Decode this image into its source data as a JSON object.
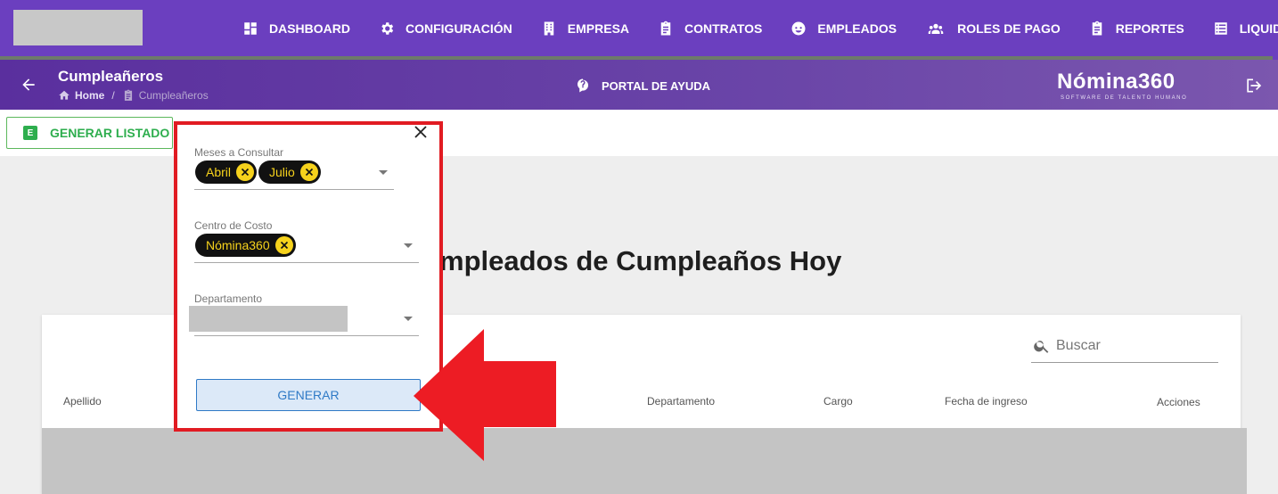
{
  "nav": {
    "items": [
      {
        "label": "DASHBOARD",
        "icon": "dashboard-icon"
      },
      {
        "label": "CONFIGURACIÓN",
        "icon": "gear-icon"
      },
      {
        "label": "EMPRESA",
        "icon": "building-icon"
      },
      {
        "label": "CONTRATOS",
        "icon": "clipboard-icon"
      },
      {
        "label": "EMPLEADOS",
        "icon": "face-icon"
      },
      {
        "label": "ROLES DE PAGO",
        "icon": "group-icon"
      },
      {
        "label": "REPORTES",
        "icon": "clipboard-icon"
      },
      {
        "label": "LIQUIDACIONE",
        "icon": "list-icon"
      }
    ],
    "colors": {
      "bar": "#6b3fbf"
    }
  },
  "subheader": {
    "title": "Cumpleañeros",
    "breadcrumb_home": "Home",
    "breadcrumb_sep": "/",
    "breadcrumb_current": "Cumpleañeros",
    "help_label": "PORTAL DE AYUDA",
    "brand": "Nómina360",
    "brand_tagline": "SOFTWARE DE TALENTO HUMANO"
  },
  "toolbar": {
    "generate_list_label": "GENERAR LISTADO",
    "excel_icon_letter": "E"
  },
  "main": {
    "title": "mpleados de Cumpleaños Hoy",
    "search_placeholder": "Buscar",
    "columns": [
      "Apellido",
      "Departamento",
      "Cargo",
      "Fecha de ingreso",
      "Acciones"
    ]
  },
  "popup": {
    "months_label": "Meses a Consultar",
    "months_selected": [
      "Abril",
      "Julio"
    ],
    "cost_center_label": "Centro de Costo",
    "cost_center_selected": [
      "Nómina360"
    ],
    "department_label": "Departamento",
    "generate_label": "GENERAR"
  },
  "colors": {
    "chip_bg": "#111111",
    "chip_text": "#f6d21c",
    "highlight": "#e11b22",
    "excel_green": "#2eae4e",
    "primary_blue": "#2f7ac6"
  }
}
